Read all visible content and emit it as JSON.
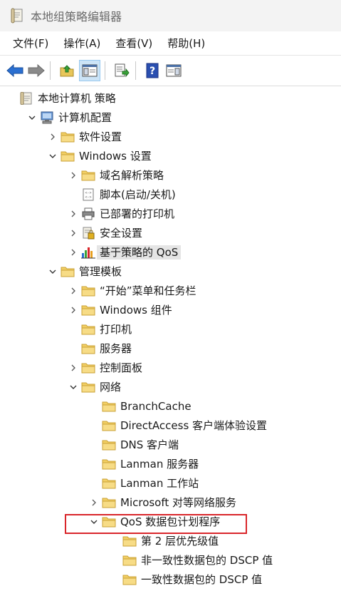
{
  "window": {
    "title": "本地组策略编辑器"
  },
  "menu": [
    "文件(F)",
    "操作(A)",
    "查看(V)",
    "帮助(H)"
  ],
  "toolbar": [
    {
      "name": "back-arrow-icon"
    },
    {
      "name": "forward-arrow-icon"
    },
    {
      "name": "up-folder-icon"
    },
    {
      "name": "show-hide-console-tree-icon"
    },
    {
      "name": "export-list-icon"
    },
    {
      "name": "help-icon"
    },
    {
      "name": "show-action-pane-icon"
    }
  ],
  "tree": [
    {
      "label": "本地计算机 策略",
      "level": 0,
      "icon": "policy",
      "expand": "none"
    },
    {
      "label": "计算机配置",
      "level": 1,
      "icon": "computer",
      "expand": "open"
    },
    {
      "label": "软件设置",
      "level": 2,
      "icon": "folder",
      "expand": "closed"
    },
    {
      "label": "Windows 设置",
      "level": 2,
      "icon": "folder",
      "expand": "open"
    },
    {
      "label": "域名解析策略",
      "level": 3,
      "icon": "folder",
      "expand": "closed"
    },
    {
      "label": "脚本(启动/关机)",
      "level": 3,
      "icon": "script",
      "expand": "none"
    },
    {
      "label": "已部署的打印机",
      "level": 3,
      "icon": "printer",
      "expand": "closed"
    },
    {
      "label": "安全设置",
      "level": 3,
      "icon": "security",
      "expand": "closed"
    },
    {
      "label": "基于策略的 QoS",
      "level": 3,
      "icon": "chart",
      "expand": "closed",
      "highlight": true
    },
    {
      "label": "管理模板",
      "level": 2,
      "icon": "folder",
      "expand": "open"
    },
    {
      "label": "“开始”菜单和任务栏",
      "level": 3,
      "icon": "folder",
      "expand": "closed"
    },
    {
      "label": "Windows 组件",
      "level": 3,
      "icon": "folder",
      "expand": "closed"
    },
    {
      "label": "打印机",
      "level": 3,
      "icon": "folder",
      "expand": "none"
    },
    {
      "label": "服务器",
      "level": 3,
      "icon": "folder",
      "expand": "none"
    },
    {
      "label": "控制面板",
      "level": 3,
      "icon": "folder",
      "expand": "closed"
    },
    {
      "label": "网络",
      "level": 3,
      "icon": "folder",
      "expand": "open"
    },
    {
      "label": "BranchCache",
      "level": 4,
      "icon": "folder",
      "expand": "none"
    },
    {
      "label": "DirectAccess 客户端体验设置",
      "level": 4,
      "icon": "folder",
      "expand": "none"
    },
    {
      "label": "DNS 客户端",
      "level": 4,
      "icon": "folder",
      "expand": "none"
    },
    {
      "label": "Lanman 服务器",
      "level": 4,
      "icon": "folder",
      "expand": "none"
    },
    {
      "label": "Lanman 工作站",
      "level": 4,
      "icon": "folder",
      "expand": "none"
    },
    {
      "label": "Microsoft 对等网络服务",
      "level": 4,
      "icon": "folder",
      "expand": "closed"
    },
    {
      "label": "QoS 数据包计划程序",
      "level": 4,
      "icon": "folder",
      "expand": "open",
      "boxed": true
    },
    {
      "label": "第 2 层优先级值",
      "level": 5,
      "icon": "folder",
      "expand": "none"
    },
    {
      "label": "非一致性数据包的 DSCP 值",
      "level": 5,
      "icon": "folder",
      "expand": "none"
    },
    {
      "label": "一致性数据包的 DSCP 值",
      "level": 5,
      "icon": "folder",
      "expand": "none"
    }
  ]
}
